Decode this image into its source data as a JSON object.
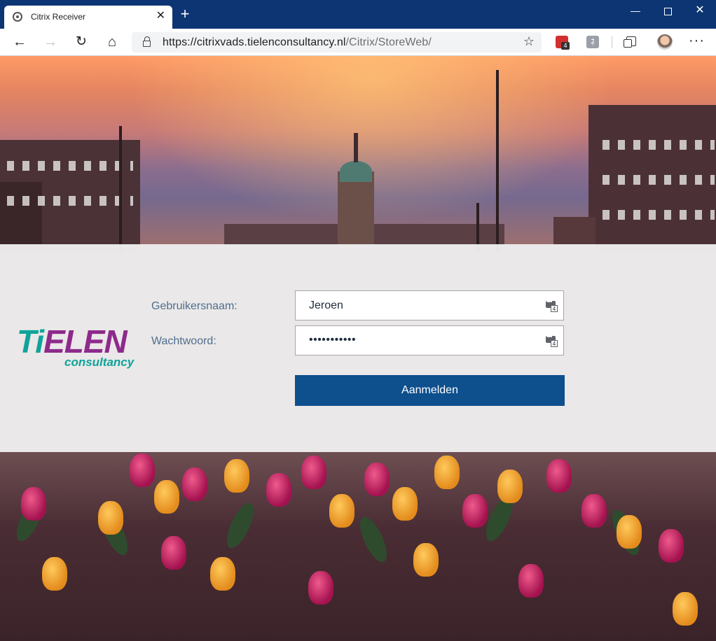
{
  "browser": {
    "tab_title": "Citrix Receiver",
    "tab_close": "✕",
    "new_tab": "+",
    "window_controls": {
      "minimize": "—",
      "close": "✕"
    },
    "address": {
      "host": "https://citrixvads.tielenconsultancy.nl",
      "path": "/Citrix/StoreWeb/"
    },
    "extensions": [
      {
        "name": "password-manager-extension",
        "badge": "4",
        "color": "#d32f2f"
      },
      {
        "name": "translate-extension",
        "glyph": "ﾈ",
        "color": "#9aa0a6"
      }
    ],
    "more_menu": "···",
    "icons": {
      "back": "←",
      "forward": "→",
      "reload": "↻",
      "home": "⌂",
      "favorite": "☆"
    },
    "titlebar_color": "#0d3573"
  },
  "logo": {
    "main_prefix": "Ti",
    "main_rest": "ELEN",
    "sub": "consultancy",
    "colors": {
      "teal": "#0fa39a",
      "purple": "#8e2a8c"
    }
  },
  "login": {
    "username_label": "Gebruikersnaam:",
    "username_value": "Jeroen",
    "password_label": "Wachtwoord:",
    "password_value": "•••••••••••",
    "password_manager_badge": "4",
    "submit_label": "Aanmelden",
    "accent_color": "#0e4f8d",
    "label_color": "#4e6e8e"
  }
}
